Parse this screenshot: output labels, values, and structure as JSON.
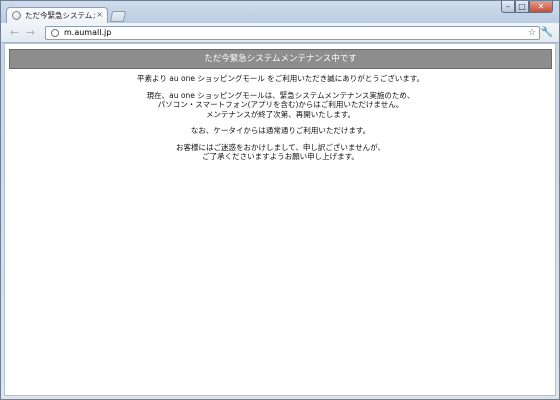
{
  "tab": {
    "title": "ただ今緊急システムメンテ",
    "close_glyph": "×",
    "favicon": "globe-icon"
  },
  "window_controls": {
    "minimize_glyph": "–",
    "maximize_glyph": "□",
    "close_glyph": "✕"
  },
  "toolbar": {
    "back_glyph": "←",
    "forward_glyph": "→",
    "url": "m.aumall.jp",
    "star_glyph": "☆",
    "wrench_glyph": "🔧"
  },
  "page": {
    "banner": "ただ今緊急システムメンテナンス中です",
    "paragraphs": [
      [
        "平素より au one ショッピングモール をご利用いただき誠にありがとうございます。"
      ],
      [
        "現在、au one ショッピングモールは、緊急システムメンテナンス実施のため、",
        "パソコン・スマートフォン(アプリを含む)からはご利用いただけません。",
        "メンテナンスが終了次第、再開いたします。"
      ],
      [
        "なお、ケータイからは通常通りご利用いただけます。"
      ],
      [
        "お客様にはご迷惑をおかけしまして、申し訳ございませんが、",
        "ご了承くださいますようお願い申し上げます。"
      ]
    ]
  },
  "colors": {
    "banner_bg": "#8d8d8d",
    "banner_text": "#ffffff",
    "body_text": "#111111"
  }
}
